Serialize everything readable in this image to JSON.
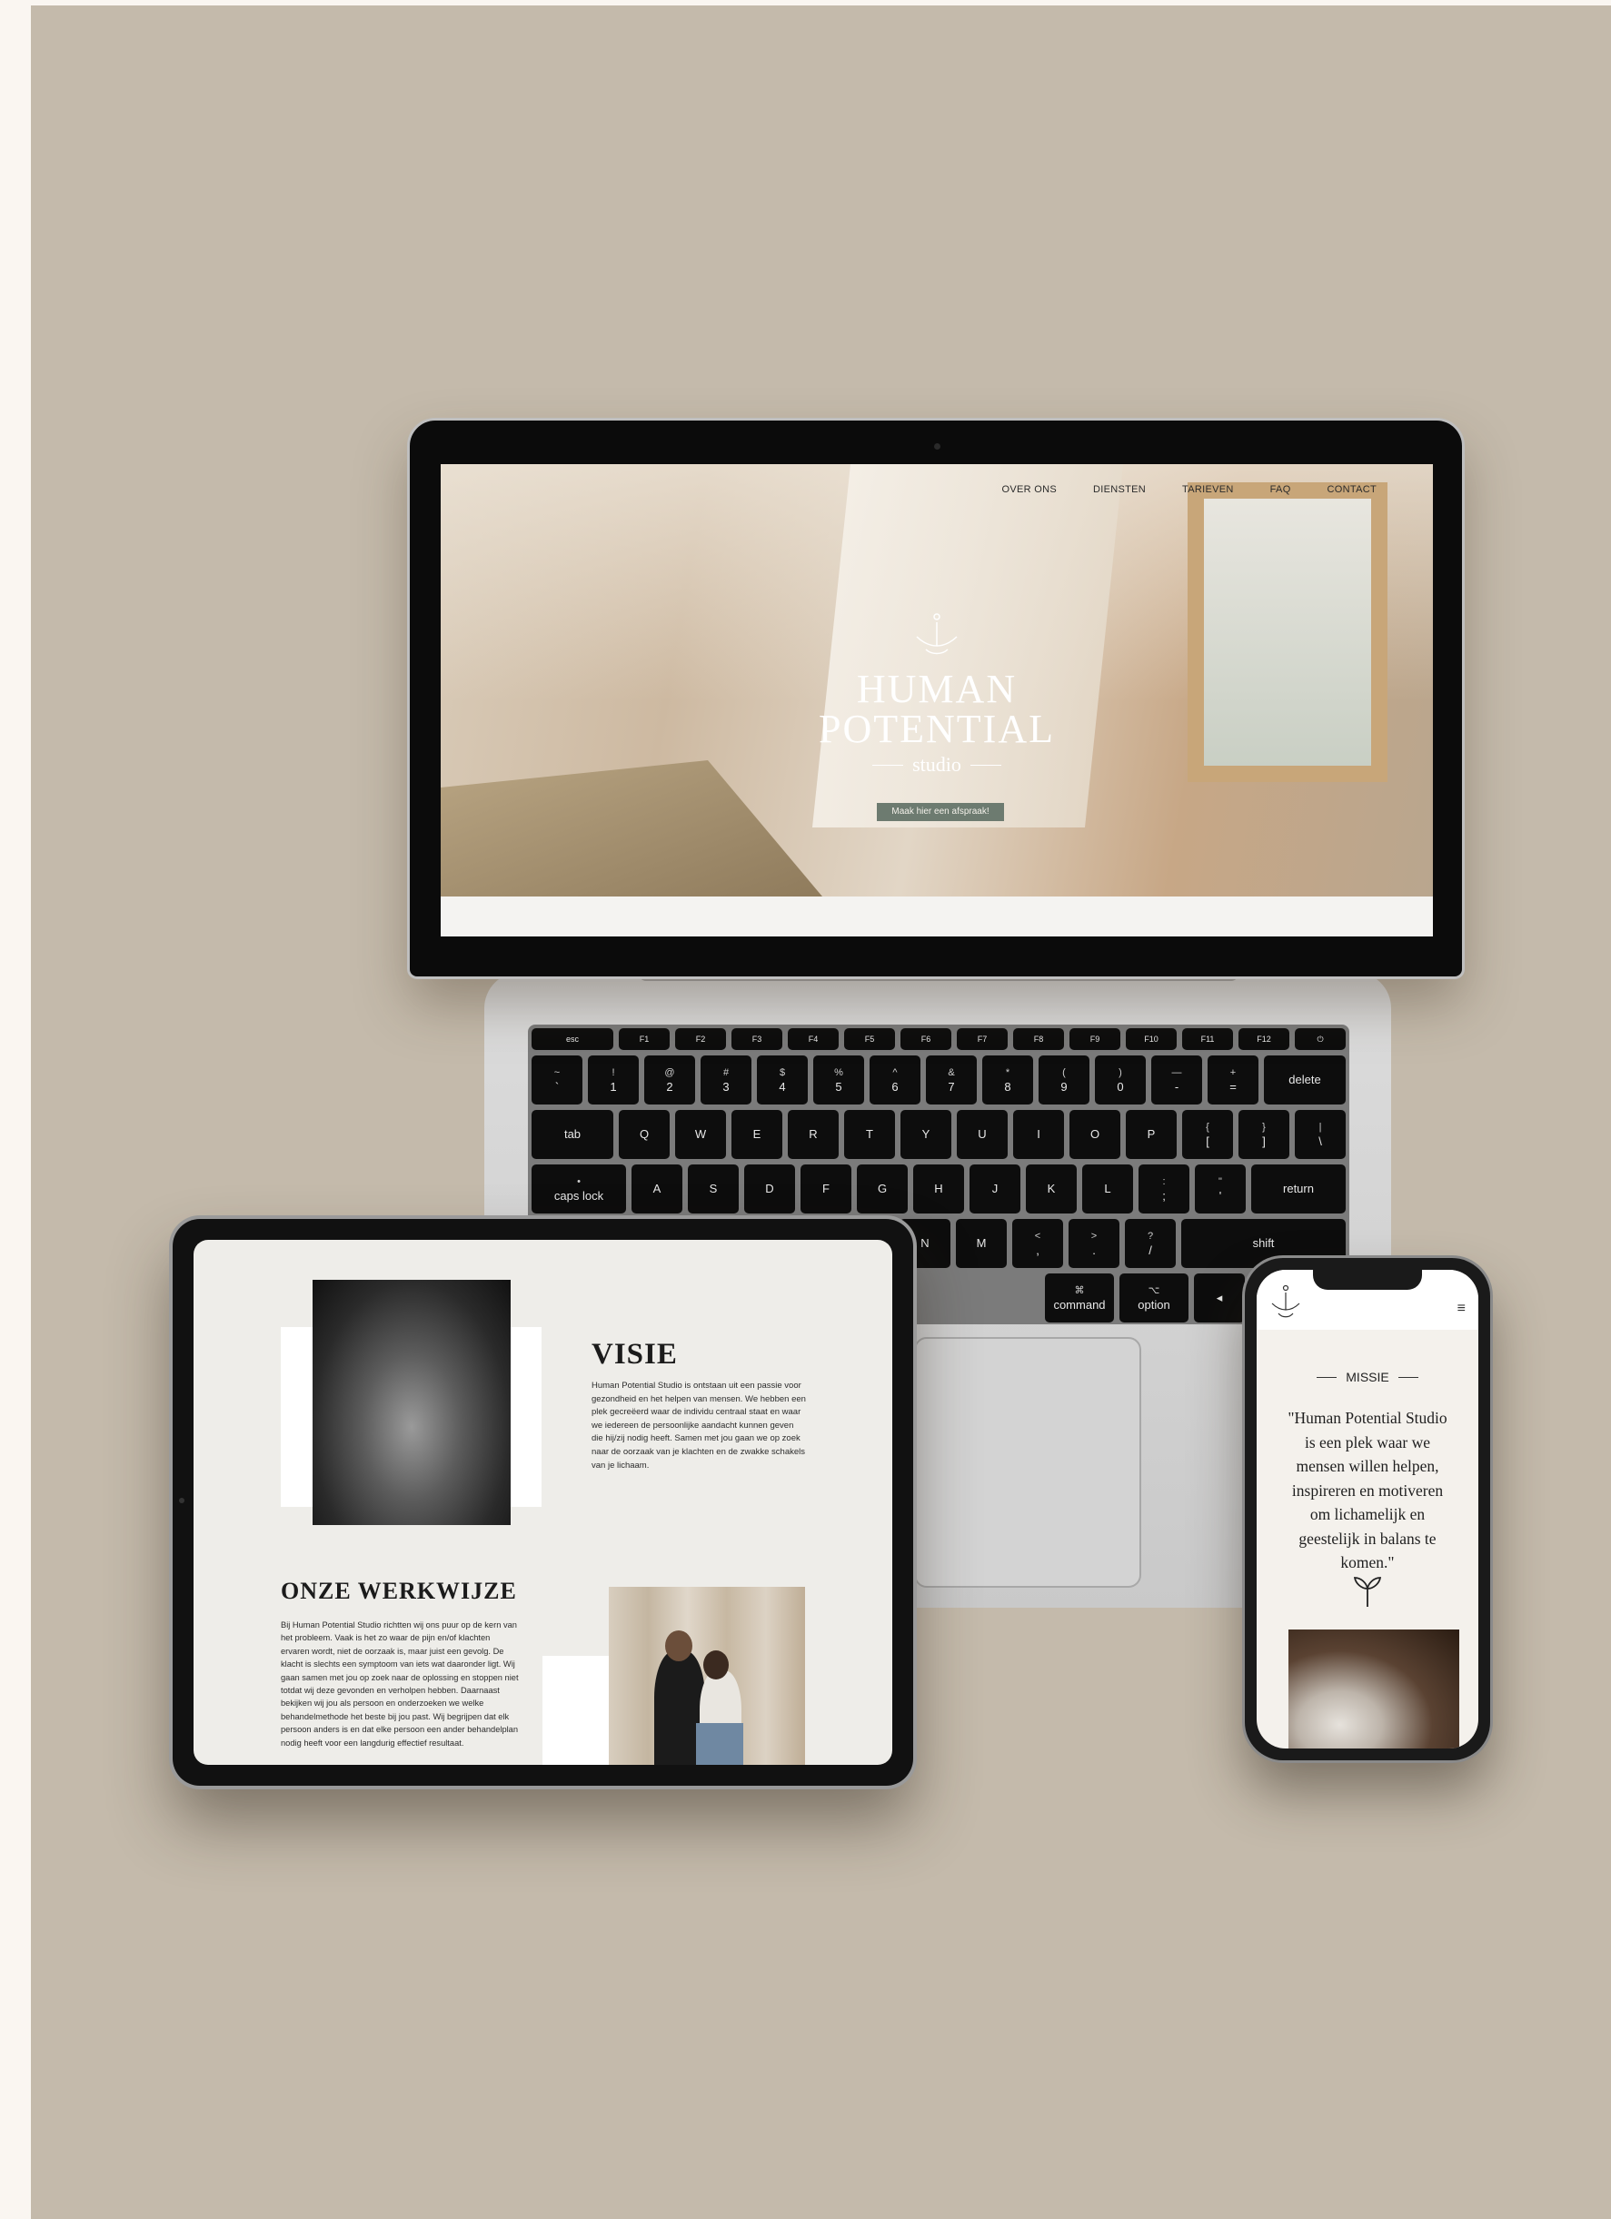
{
  "laptop": {
    "nav": [
      "OVER ONS",
      "DIENSTEN",
      "TARIEVEN",
      "FAQ",
      "CONTACT"
    ],
    "logo": {
      "line1": "HUMAN",
      "line2": "POTENTIAL",
      "line3": "studio"
    },
    "cta_label": "Maak hier een afspraak!",
    "accent": "#6d7b70"
  },
  "keyboard": {
    "fn_row": [
      "esc",
      "F1",
      "F2",
      "F3",
      "F4",
      "F5",
      "F6",
      "F7",
      "F8",
      "F9",
      "F10",
      "F11",
      "F12",
      "⏻"
    ],
    "num_row": [
      [
        "~",
        "`"
      ],
      [
        "!",
        "1"
      ],
      [
        "@",
        "2"
      ],
      [
        "#",
        "3"
      ],
      [
        "$",
        "4"
      ],
      [
        "%",
        "5"
      ],
      [
        "^",
        "6"
      ],
      [
        "&",
        "7"
      ],
      [
        "*",
        "8"
      ],
      [
        "(",
        "9"
      ],
      [
        ")",
        "0"
      ],
      [
        "—",
        "-"
      ],
      [
        "+",
        "="
      ],
      [
        "",
        "delete"
      ]
    ],
    "q_row": [
      [
        "",
        "tab"
      ],
      [
        "",
        "Q"
      ],
      [
        "",
        "W"
      ],
      [
        "",
        "E"
      ],
      [
        "",
        "R"
      ],
      [
        "",
        "T"
      ],
      [
        "",
        "Y"
      ],
      [
        "",
        "U"
      ],
      [
        "",
        "I"
      ],
      [
        "",
        "O"
      ],
      [
        "",
        "P"
      ],
      [
        "{",
        "["
      ],
      [
        "}",
        "]"
      ],
      [
        "|",
        "\\"
      ]
    ],
    "a_row": [
      [
        "•",
        "caps lock"
      ],
      [
        "",
        "A"
      ],
      [
        "",
        "S"
      ],
      [
        "",
        "D"
      ],
      [
        "",
        "F"
      ],
      [
        "",
        "G"
      ],
      [
        "",
        "H"
      ],
      [
        "",
        "J"
      ],
      [
        "",
        "K"
      ],
      [
        "",
        "L"
      ],
      [
        ":",
        ";"
      ],
      [
        "\"",
        "'"
      ],
      [
        "",
        "return"
      ]
    ],
    "z_row": [
      [
        "",
        "N"
      ],
      [
        "",
        "M"
      ],
      [
        "<",
        ","
      ],
      [
        ">",
        "."
      ],
      [
        "?",
        "/"
      ],
      [
        "",
        "shift"
      ]
    ],
    "bottom_row": [
      [
        "⌘",
        "command"
      ],
      [
        "⌥",
        "option"
      ],
      [
        "",
        "◂"
      ]
    ]
  },
  "tablet": {
    "visie_title": "VISIE",
    "visie_text": "Human Potential Studio is ontstaan uit een passie voor gezondheid en het helpen van mensen. We hebben een plek gecreëerd waar de individu centraal staat en waar we iedereen de persoonlijke aandacht kunnen geven die hij/zij nodig heeft. Samen met jou gaan we op zoek naar de oorzaak van je klachten en de zwakke schakels van je lichaam.",
    "werkwijze_title": "ONZE WERKWIJZE",
    "werkwijze_text": "Bij Human Potential Studio richtten wij ons puur op de kern van het probleem. Vaak is het zo waar de pijn en/of klachten ervaren wordt, niet de oorzaak is, maar juist een gevolg. De klacht is slechts een symptoom van iets wat daaronder ligt. Wij gaan samen met jou op zoek naar de oplossing en stoppen niet totdat wij deze gevonden en verholpen hebben. Daarnaast bekijken wij jou als persoon en onderzoeken we welke behandelmethode het beste bij jou past. Wij begrijpen dat elk persoon anders is en dat elke persoon een ander behandelplan nodig heeft voor een langdurig effectief resultaat."
  },
  "phone": {
    "menu_icon": "≡",
    "missie_label": "MISSIE",
    "quote": "\"Human Potential Studio is een plek waar we mensen willen helpen, inspireren en motiveren om lichamelijk en geestelijk in balans te komen.\""
  }
}
